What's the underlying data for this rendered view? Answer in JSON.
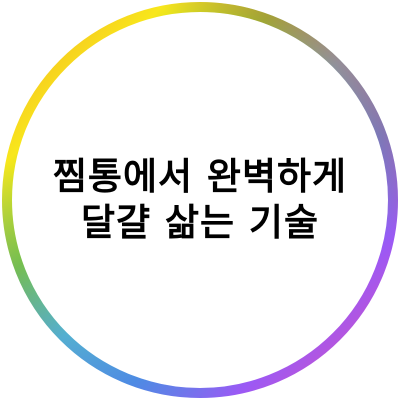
{
  "title": {
    "line1": "찜통에서 완벽하게",
    "line2": "달걀 삶는 기술"
  },
  "ring": {
    "gradient_colors": [
      "#e8475f",
      "#f5a623",
      "#f8e71c",
      "#7ed321",
      "#50c8c6",
      "#4a90e2",
      "#9b59f5",
      "#e84fb0"
    ]
  }
}
